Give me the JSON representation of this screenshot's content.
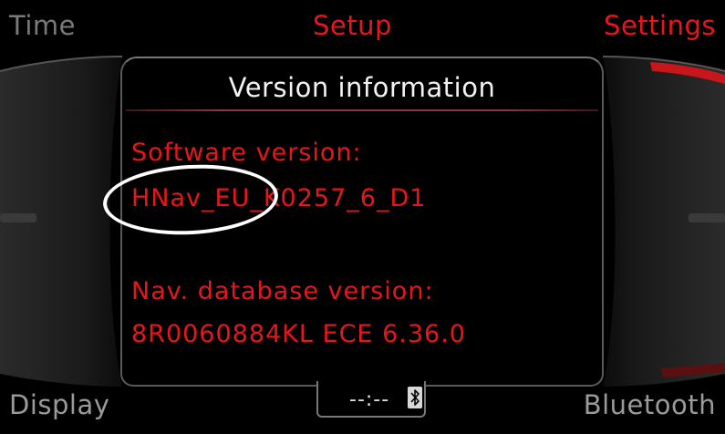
{
  "corners": {
    "top_left": "Time",
    "top_center": "Setup",
    "top_right": "Settings",
    "bottom_left": "Display",
    "bottom_right": "Bluetooth"
  },
  "panel": {
    "title": "Version information",
    "software_label": "Software version:",
    "software_value": "HNav_EU_K0257_6_D1",
    "database_label": "Nav. database version:",
    "database_value": "8R0060884KL ECE 6.36.0"
  },
  "status": {
    "clock": "--:--",
    "bluetooth_icon": "bluetooth-icon"
  },
  "colors": {
    "accent": "#e8161b",
    "title_text": "#f2f2f2",
    "inactive_text": "#7a7a7a"
  }
}
